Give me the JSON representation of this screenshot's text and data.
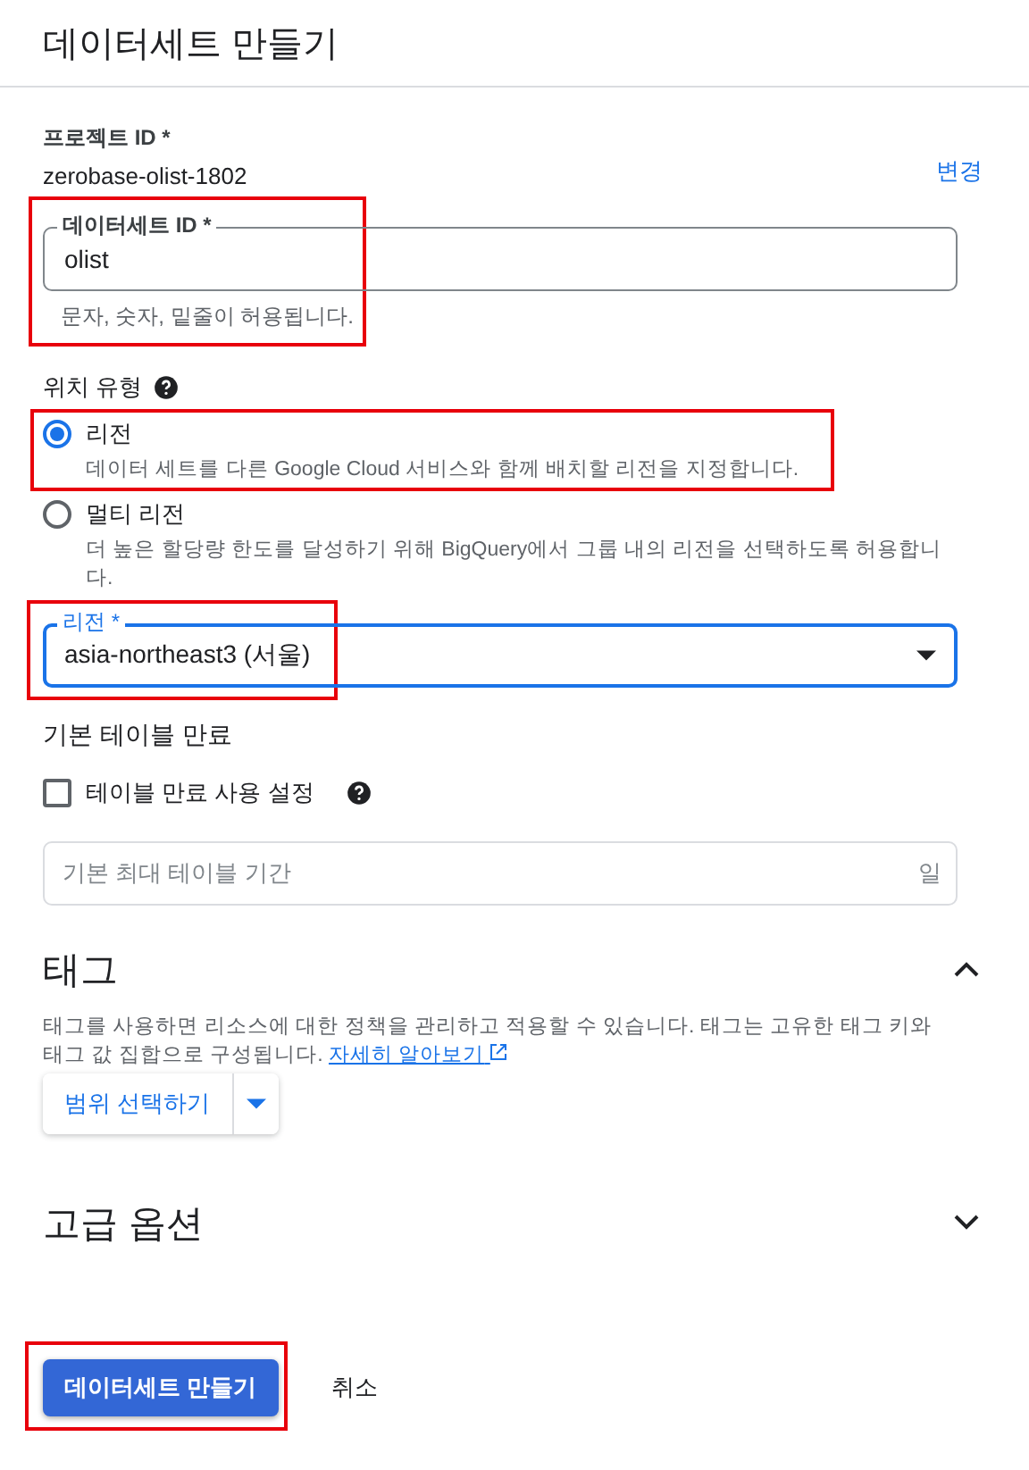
{
  "title": "데이터세트 만들기",
  "project": {
    "label": "프로젝트 ID *",
    "value": "zerobase-olist-1802",
    "change_link": "변경"
  },
  "dataset_id": {
    "label": "데이터세트 ID *",
    "value": "olist",
    "hint": "문자, 숫자, 밑줄이 허용됩니다.",
    "highlighted": true
  },
  "location_type": {
    "label": "위치 유형",
    "help_icon": true,
    "options": [
      {
        "label": "리전",
        "description": "데이터 세트를 다른 Google Cloud 서비스와 함께 배치할 리전을 지정합니다.",
        "selected": true,
        "highlighted": true
      },
      {
        "label": "멀티 리전",
        "description": "더 높은 할당량 한도를 달성하기 위해 BigQuery에서 그룹 내의 리전을 선택하도록 허용합니다.",
        "selected": false,
        "highlighted": false
      }
    ]
  },
  "region": {
    "label": "리전 *",
    "value": "asia-northeast3 (서울)",
    "focused": true,
    "highlighted": true
  },
  "expiration": {
    "heading": "기본 테이블 만료",
    "checkbox": {
      "label": "테이블 만료 사용 설정",
      "checked": false
    },
    "field": {
      "placeholder": "기본 최대 테이블 기간",
      "suffix": "일"
    }
  },
  "tags": {
    "heading": "태그",
    "expanded": true,
    "description": "태그를 사용하면 리소스에 대한 정책을 관리하고 적용할 수 있습니다. 태그는 고유한 태그 키와 태그 값 집합으로 구성됩니다.",
    "link": "자세히 알아보기",
    "scope_button": "범위 선택하기"
  },
  "advanced": {
    "heading": "고급 옵션",
    "expanded": false
  },
  "actions": {
    "primary": "데이터세트 만들기",
    "cancel": "취소",
    "primary_highlighted": true
  }
}
